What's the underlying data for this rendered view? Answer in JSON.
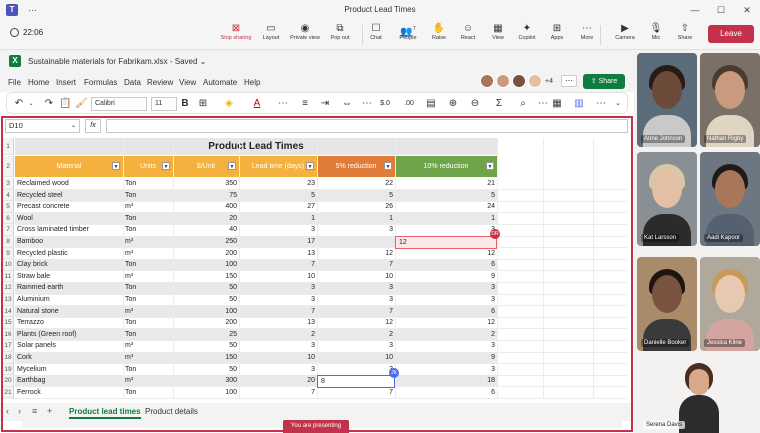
{
  "window": {
    "title": "Product Lead Times"
  },
  "meeting": {
    "timer": "22:06",
    "buttons": [
      {
        "id": "stop_sharing",
        "label": "Stop sharing",
        "icon": "stop-share-icon",
        "glyph": "⊠"
      },
      {
        "id": "layout",
        "label": "Layout",
        "icon": "layout-icon",
        "glyph": "▭"
      },
      {
        "id": "private_view",
        "label": "Private view",
        "icon": "private-view-icon",
        "glyph": "◉"
      },
      {
        "id": "pop_out",
        "label": "Pop out",
        "icon": "pop-out-icon",
        "glyph": "⧉"
      },
      {
        "id": "chat",
        "label": "Chat",
        "icon": "chat-icon",
        "glyph": "☐"
      },
      {
        "id": "people",
        "label": "People",
        "icon": "people-icon",
        "glyph": "👥",
        "count": "7"
      },
      {
        "id": "raise",
        "label": "Raise",
        "icon": "raise-hand-icon",
        "glyph": "✋"
      },
      {
        "id": "react",
        "label": "React",
        "icon": "react-icon",
        "glyph": "☺"
      },
      {
        "id": "view",
        "label": "View",
        "icon": "view-icon",
        "glyph": "▦"
      },
      {
        "id": "copilot",
        "label": "Copilot",
        "icon": "copilot-icon",
        "glyph": "✦"
      },
      {
        "id": "apps",
        "label": "Apps",
        "icon": "apps-icon",
        "glyph": "⊞"
      },
      {
        "id": "more",
        "label": "More",
        "icon": "more-icon",
        "glyph": "⋯"
      },
      {
        "id": "camera",
        "label": "Camera",
        "icon": "camera-icon",
        "glyph": "▶"
      },
      {
        "id": "mic",
        "label": "Mic",
        "icon": "mic-icon",
        "glyph": "🎙"
      },
      {
        "id": "share",
        "label": "Share",
        "icon": "share-icon",
        "glyph": "⇧"
      }
    ],
    "leave_label": "Leave"
  },
  "excel": {
    "file_name": "Sustainable materials for Fabrikam.xlsx",
    "saved_status": "Saved",
    "menu": [
      "File",
      "Home",
      "Insert",
      "Formulas",
      "Data",
      "Review",
      "View",
      "Automate",
      "Help"
    ],
    "collaborators_more": "+4",
    "share_label": "Share",
    "font_name": "Calibri",
    "font_size": "11",
    "name_box": "D10",
    "fx_label": "fx",
    "presenting_label": "You are presenting"
  },
  "sheet": {
    "title": "Product Lead Times",
    "headers": [
      "Material",
      "Units",
      "$/Unit",
      "Lead time (days)",
      "5% reduction",
      "10% reduction"
    ],
    "header_colors": [
      "#f4b13e",
      "#f4b13e",
      "#f4b13e",
      "#f4b13e",
      "#e07b39",
      "#6fa54a"
    ],
    "rows": [
      [
        "Reclaimed wood",
        "Ton",
        "350",
        "23",
        "22",
        "21"
      ],
      [
        "Recycled steel",
        "Ton",
        "75",
        "5",
        "5",
        "5"
      ],
      [
        "Precast concrete",
        "m³",
        "400",
        "27",
        "26",
        "24"
      ],
      [
        "Wool",
        "Ton",
        "20",
        "1",
        "1",
        "1"
      ],
      [
        "Cross laminated timber",
        "Ton",
        "40",
        "3",
        "3",
        "3"
      ],
      [
        "Bamboo",
        "m³",
        "250",
        "17",
        "",
        ""
      ],
      [
        "Recycled plastic",
        "m³",
        "200",
        "13",
        "12",
        "12"
      ],
      [
        "Clay brick",
        "Ton",
        "100",
        "7",
        "7",
        "6"
      ],
      [
        "Straw bale",
        "m³",
        "150",
        "10",
        "10",
        "9"
      ],
      [
        "Rammed earth",
        "Ton",
        "50",
        "3",
        "3",
        "3"
      ],
      [
        "Aluminium",
        "Ton",
        "50",
        "3",
        "3",
        "3"
      ],
      [
        "Natural stone",
        "m³",
        "100",
        "7",
        "7",
        "6"
      ],
      [
        "Terrazzo",
        "Ton",
        "200",
        "13",
        "12",
        "12"
      ],
      [
        "Plants (Green roof)",
        "Ton",
        "25",
        "2",
        "2",
        "2"
      ],
      [
        "Solar panels",
        "m³",
        "50",
        "3",
        "3",
        "3"
      ],
      [
        "Cork",
        "m³",
        "150",
        "10",
        "10",
        "9"
      ],
      [
        "Mycelium",
        "Ton",
        "50",
        "3",
        "3",
        "3"
      ],
      [
        "Earthbag",
        "m³",
        "300",
        "20",
        "",
        "18"
      ],
      [
        "Ferrock",
        "Ton",
        "100",
        "7",
        "7",
        "6"
      ]
    ],
    "edit_red": {
      "value": "12",
      "badge": "DR"
    },
    "edit_blue": {
      "value": "8",
      "badge": "JK"
    },
    "tabs": [
      "Product lead times",
      "Product details"
    ]
  },
  "participants": [
    {
      "name": "Anne Johnson",
      "skin": "#6b4a3a",
      "hair": "#2a1a14",
      "shirt": "#c9c9c9",
      "bg": "#5b6b7a"
    },
    {
      "name": "Nathan Rigby",
      "skin": "#c99a7d",
      "hair": "#4a3a30",
      "shirt": "#e0d5c2",
      "bg": "#7a7068"
    },
    {
      "name": "Kat Larsson",
      "skin": "#e3c0a5",
      "hair": "#d8c8a5",
      "shirt": "#2b2b2b",
      "bg": "#8a8f94"
    },
    {
      "name": "Aadi Kapoor",
      "skin": "#a87658",
      "hair": "#1e1a18",
      "shirt": "#556070",
      "bg": "#6d7782"
    },
    {
      "name": "Danielle Booker",
      "skin": "#7a5240",
      "hair": "#1e1410",
      "shirt": "#3a3a3a",
      "bg": "#a98b6a"
    },
    {
      "name": "Jessica Kline",
      "skin": "#e8c8b0",
      "hair": "#c79a5a",
      "shirt": "#d4a4a0",
      "bg": "#b0a89a"
    },
    {
      "name": "Serena Davis",
      "skin": "#d9a88a",
      "hair": "#4a2e20",
      "shirt": "#2c2c2c",
      "bg": "#f3f2f1"
    }
  ]
}
